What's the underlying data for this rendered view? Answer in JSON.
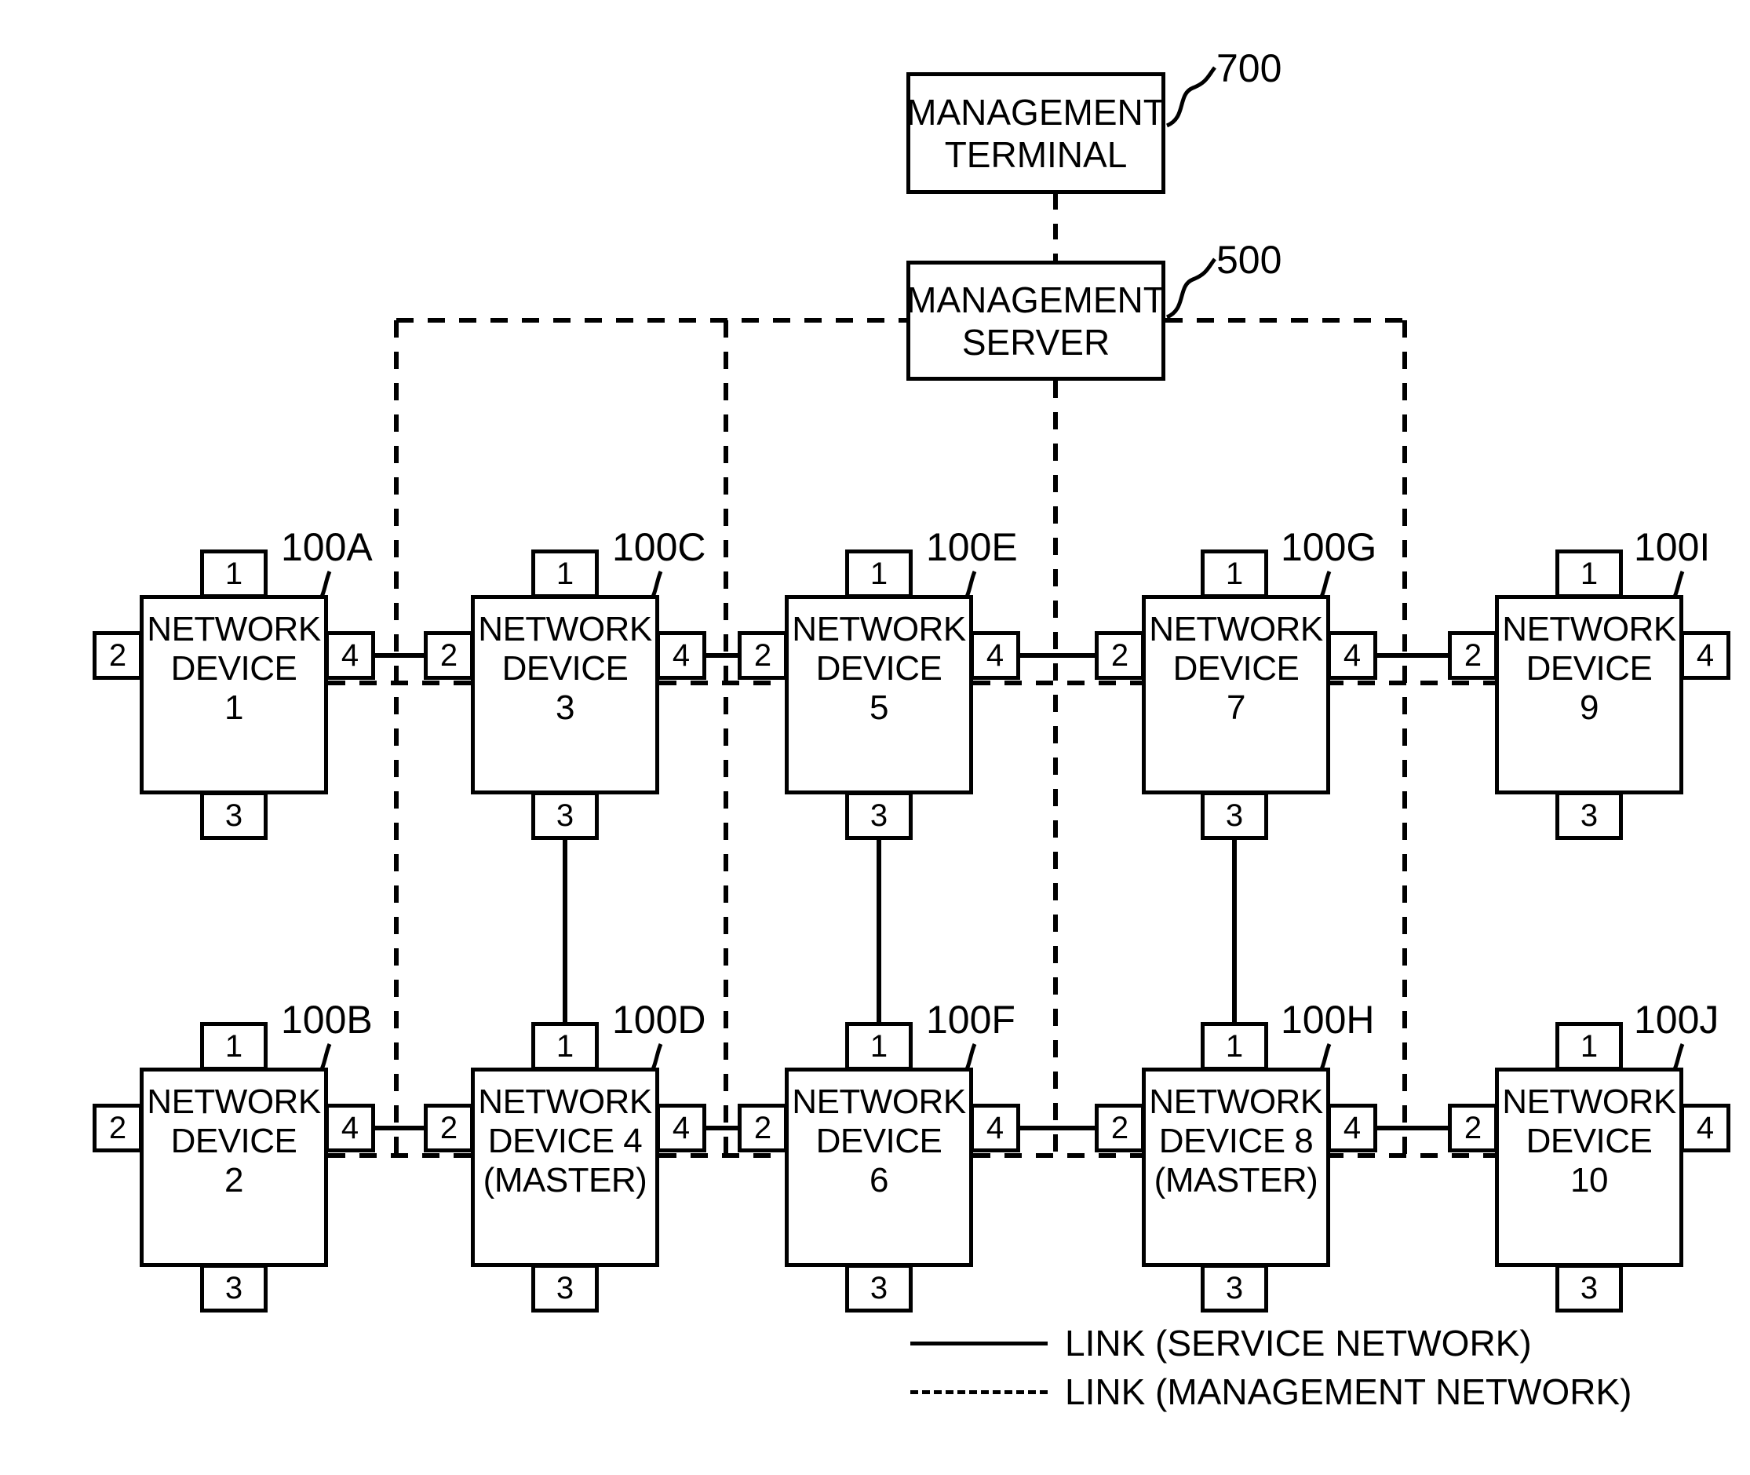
{
  "figure": {
    "type": "network-topology-diagram",
    "management_terminal": {
      "ref": "700",
      "lines": [
        "MANAGEMENT",
        "TERMINAL"
      ]
    },
    "management_server": {
      "ref": "500",
      "lines": [
        "MANAGEMENT",
        "SERVER"
      ]
    }
  },
  "devices": [
    {
      "ref": "100A",
      "lines": [
        "NETWORK",
        "DEVICE",
        "1"
      ],
      "ports": {
        "top": "1",
        "left": "2",
        "bottom": "3",
        "right": "4"
      }
    },
    {
      "ref": "100C",
      "lines": [
        "NETWORK",
        "DEVICE",
        "3"
      ],
      "ports": {
        "top": "1",
        "left": "2",
        "bottom": "3",
        "right": "4"
      }
    },
    {
      "ref": "100E",
      "lines": [
        "NETWORK",
        "DEVICE",
        "5"
      ],
      "ports": {
        "top": "1",
        "left": "2",
        "bottom": "3",
        "right": "4"
      }
    },
    {
      "ref": "100G",
      "lines": [
        "NETWORK",
        "DEVICE",
        "7"
      ],
      "ports": {
        "top": "1",
        "left": "2",
        "bottom": "3",
        "right": "4"
      }
    },
    {
      "ref": "100I",
      "lines": [
        "NETWORK",
        "DEVICE",
        "9"
      ],
      "ports": {
        "top": "1",
        "left": "2",
        "bottom": "3",
        "right": "4"
      }
    },
    {
      "ref": "100B",
      "lines": [
        "NETWORK",
        "DEVICE",
        "2"
      ],
      "ports": {
        "top": "1",
        "left": "2",
        "bottom": "3",
        "right": "4"
      }
    },
    {
      "ref": "100D",
      "lines": [
        "NETWORK",
        "DEVICE 4",
        "(MASTER)"
      ],
      "ports": {
        "top": "1",
        "left": "2",
        "bottom": "3",
        "right": "4"
      }
    },
    {
      "ref": "100F",
      "lines": [
        "NETWORK",
        "DEVICE",
        "6"
      ],
      "ports": {
        "top": "1",
        "left": "2",
        "bottom": "3",
        "right": "4"
      }
    },
    {
      "ref": "100H",
      "lines": [
        "NETWORK",
        "DEVICE 8",
        "(MASTER)"
      ],
      "ports": {
        "top": "1",
        "left": "2",
        "bottom": "3",
        "right": "4"
      }
    },
    {
      "ref": "100J",
      "lines": [
        "NETWORK",
        "DEVICE",
        "10"
      ],
      "ports": {
        "top": "1",
        "left": "2",
        "bottom": "3",
        "right": "4"
      }
    }
  ],
  "legend": {
    "items": [
      {
        "style": "solid",
        "label": "LINK (SERVICE NETWORK)"
      },
      {
        "style": "dashed",
        "label": "LINK (MANAGEMENT NETWORK)"
      }
    ]
  },
  "colors": {
    "ink": "#000000",
    "paper": "#ffffff"
  }
}
